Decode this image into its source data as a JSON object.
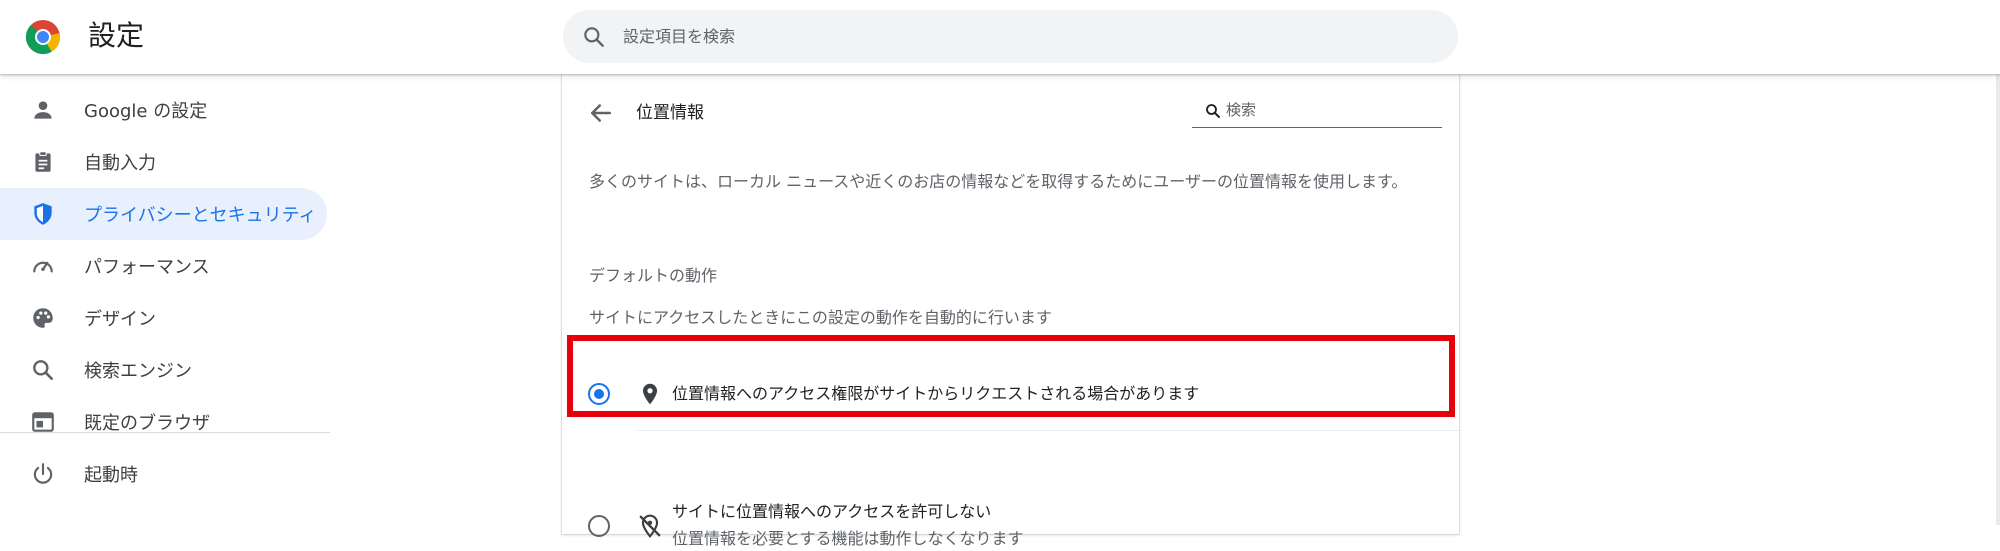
{
  "app": {
    "title": "設定"
  },
  "search": {
    "placeholder": "設定項目を検索"
  },
  "sidebar": {
    "items": [
      {
        "label": "Google の設定",
        "icon": "person-icon"
      },
      {
        "label": "自動入力",
        "icon": "clipboard-icon"
      },
      {
        "label": "プライバシーとセキュリティ",
        "icon": "shield-icon",
        "active": true
      },
      {
        "label": "パフォーマンス",
        "icon": "speedometer-icon"
      },
      {
        "label": "デザイン",
        "icon": "palette-icon"
      },
      {
        "label": "検索エンジン",
        "icon": "search-icon"
      },
      {
        "label": "既定のブラウザ",
        "icon": "browser-icon"
      },
      {
        "label": "起動時",
        "icon": "power-icon"
      }
    ]
  },
  "page": {
    "title": "位置情報",
    "search_placeholder": "検索",
    "description": "多くのサイトは、ローカル ニュースや近くのお店の情報などを取得するためにユーザーの位置情報を使用します。",
    "default_behavior": {
      "heading": "デフォルトの動作",
      "subtext": "サイトにアクセスしたときにこの設定の動作を自動的に行います",
      "options": [
        {
          "label": "位置情報へのアクセス権限がサイトからリクエストされる場合があります",
          "selected": true,
          "icon": "location-pin-icon"
        },
        {
          "label": "サイトに位置情報へのアクセスを許可しない",
          "sublabel": "位置情報を必要とする機能は動作しなくなります",
          "selected": false,
          "icon": "location-off-icon"
        }
      ]
    }
  },
  "colors": {
    "accent": "#1a73e8",
    "active_bg": "#e8f0fe",
    "highlight": "#e8000b"
  }
}
